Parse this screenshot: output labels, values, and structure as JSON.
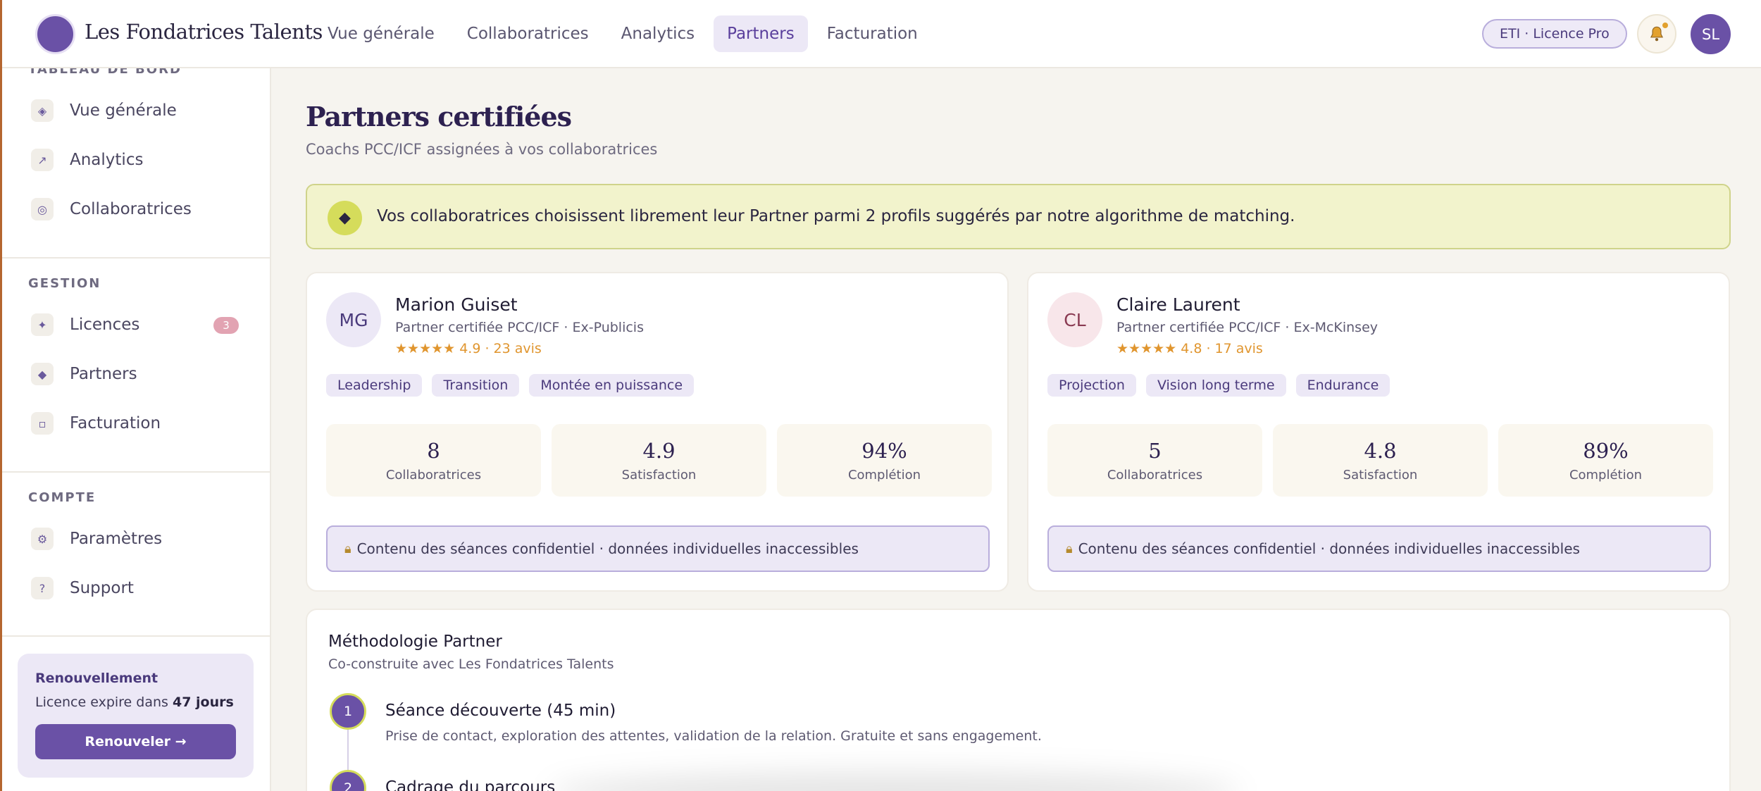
{
  "brand": {
    "name": "Les Fondatrices Talents"
  },
  "nav": {
    "items": [
      {
        "label": "Vue générale",
        "active": false
      },
      {
        "label": "Collaboratrices",
        "active": false
      },
      {
        "label": "Analytics",
        "active": false
      },
      {
        "label": "Partners",
        "active": true
      },
      {
        "label": "Facturation",
        "active": false
      }
    ]
  },
  "topbar": {
    "license": "ETI · Licence Pro",
    "user_initials": "SL"
  },
  "sidebar": {
    "sections": [
      {
        "label": "TABLEAU DE BORD",
        "items": [
          {
            "label": "Vue générale",
            "icon": "diamond-outline-icon"
          },
          {
            "label": "Analytics",
            "icon": "trend-arrow-icon"
          },
          {
            "label": "Collaboratrices",
            "icon": "target-icon"
          }
        ]
      },
      {
        "label": "GESTION",
        "items": [
          {
            "label": "Licences",
            "icon": "sparkle-icon",
            "badge": "3"
          },
          {
            "label": "Partners",
            "icon": "diamond-icon"
          },
          {
            "label": "Facturation",
            "icon": "square-icon"
          }
        ]
      },
      {
        "label": "COMPTE",
        "items": [
          {
            "label": "Paramètres",
            "icon": "gear-icon"
          },
          {
            "label": "Support",
            "icon": "question-icon"
          }
        ]
      }
    ],
    "renewal": {
      "title": "Renouvellement",
      "text": "Licence expire dans ",
      "days": "47 jours",
      "button": "Renouveler →"
    }
  },
  "page": {
    "title": "Partners certifiées",
    "subtitle": "Coachs PCC/ICF assignées à vos collaboratrices"
  },
  "notice": {
    "text": "Vos collaboratrices choisissent librement leur Partner parmi 2 profils suggérés par notre algorithme de matching."
  },
  "partners": [
    {
      "initials": "MG",
      "name": "Marion Guiset",
      "role": "Partner certifiée PCC/ICF · Ex-Publicis",
      "rating": "★★★★★ 4.9 · 23 avis",
      "tags": [
        "Leadership",
        "Transition",
        "Montée en puissance"
      ],
      "stats": [
        {
          "value": "8",
          "label": "Collaboratrices"
        },
        {
          "value": "4.9",
          "label": "Satisfaction"
        },
        {
          "value": "94%",
          "label": "Complétion"
        }
      ],
      "confidential": "Contenu des séances confidentiel · données individuelles inaccessibles",
      "avatar_bg": "#ece8f6",
      "avatar_fg": "#4a3a7c"
    },
    {
      "initials": "CL",
      "name": "Claire Laurent",
      "role": "Partner certifiée PCC/ICF · Ex-McKinsey",
      "rating": "★★★★★ 4.8 · 17 avis",
      "tags": [
        "Projection",
        "Vision long terme",
        "Endurance"
      ],
      "stats": [
        {
          "value": "5",
          "label": "Collaboratrices"
        },
        {
          "value": "4.8",
          "label": "Satisfaction"
        },
        {
          "value": "89%",
          "label": "Complétion"
        }
      ],
      "confidential": "Contenu des séances confidentiel · données individuelles inaccessibles",
      "avatar_bg": "#f8e6ea",
      "avatar_fg": "#8a3a52"
    }
  ],
  "methodology": {
    "title": "Méthodologie Partner",
    "subtitle": "Co-construite avec Les Fondatrices Talents",
    "steps": [
      {
        "num": "1",
        "title": "Séance découverte (45 min)",
        "desc": "Prise de contact, exploration des attentes, validation de la relation. Gratuite et sans engagement."
      },
      {
        "num": "2",
        "title": "Cadrage du parcours",
        "desc": ""
      }
    ]
  },
  "colors": {
    "accent": "#6a51a6",
    "highlight": "#d5dc5b",
    "star": "#e0952e"
  }
}
